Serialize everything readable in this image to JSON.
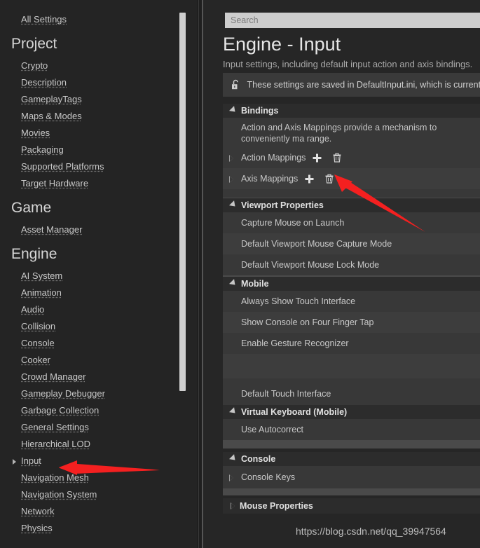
{
  "sidebar": {
    "top_link": "All Settings",
    "categories": [
      {
        "name": "Project",
        "items": [
          {
            "label": "Crypto"
          },
          {
            "label": "Description"
          },
          {
            "label": "GameplayTags"
          },
          {
            "label": "Maps & Modes"
          },
          {
            "label": "Movies"
          },
          {
            "label": "Packaging"
          },
          {
            "label": "Supported Platforms"
          },
          {
            "label": "Target Hardware"
          }
        ]
      },
      {
        "name": "Game",
        "items": [
          {
            "label": "Asset Manager"
          }
        ]
      },
      {
        "name": "Engine",
        "items": [
          {
            "label": "AI System"
          },
          {
            "label": "Animation"
          },
          {
            "label": "Audio"
          },
          {
            "label": "Collision"
          },
          {
            "label": "Console"
          },
          {
            "label": "Cooker"
          },
          {
            "label": "Crowd Manager"
          },
          {
            "label": "Gameplay Debugger"
          },
          {
            "label": "Garbage Collection"
          },
          {
            "label": "General Settings"
          },
          {
            "label": "Hierarchical LOD"
          },
          {
            "label": "Input",
            "expandable": true,
            "selected": true
          },
          {
            "label": "Navigation Mesh"
          },
          {
            "label": "Navigation System"
          },
          {
            "label": "Network"
          },
          {
            "label": "Physics"
          }
        ]
      }
    ]
  },
  "search": {
    "placeholder": "Search",
    "value": ""
  },
  "header": {
    "title": "Engine - Input",
    "subtitle": "Input settings, including default input action and axis bindings.",
    "notice_text": "These settings are saved in DefaultInput.ini, which is currently writ",
    "notice_icon": "unlocked-padlock-icon"
  },
  "sections": [
    {
      "title": "Bindings",
      "expanded": true,
      "description": "Action and Axis Mappings provide a mechanism to conveniently ma range.",
      "rows": [
        {
          "label": "Action Mappings",
          "expandable": true,
          "add": true,
          "remove": true
        },
        {
          "label": "Axis Mappings",
          "expandable": true,
          "add": true,
          "remove": true
        }
      ]
    },
    {
      "title": "Viewport Properties",
      "expanded": true,
      "rows": [
        {
          "label": "Capture Mouse on Launch"
        },
        {
          "label": "Default Viewport Mouse Capture Mode"
        },
        {
          "label": "Default Viewport Mouse Lock Mode"
        }
      ]
    },
    {
      "title": "Mobile",
      "expanded": true,
      "rows": [
        {
          "label": "Always Show Touch Interface"
        },
        {
          "label": "Show Console on Four Finger Tap"
        },
        {
          "label": "Enable Gesture Recognizer"
        },
        {
          "label": ""
        },
        {
          "label": "Default Touch Interface"
        }
      ]
    },
    {
      "title": "Virtual Keyboard (Mobile)",
      "expanded": true,
      "rows": [
        {
          "label": "Use Autocorrect"
        }
      ]
    },
    {
      "title": "Console",
      "expanded": true,
      "rows": [
        {
          "label": "Console Keys",
          "expandable": true
        }
      ]
    },
    {
      "title": "Mouse Properties",
      "expanded": false,
      "rows": []
    }
  ],
  "watermark": "https://blog.csdn.net/qq_39947564",
  "colors": {
    "accent_arrow": "#f42020",
    "panel_bg": "#262626",
    "row_bg": "#383838",
    "section_head_bg": "#2c2c2c",
    "sidebar_bg": "#242424",
    "search_bg": "#cdcdcd"
  }
}
